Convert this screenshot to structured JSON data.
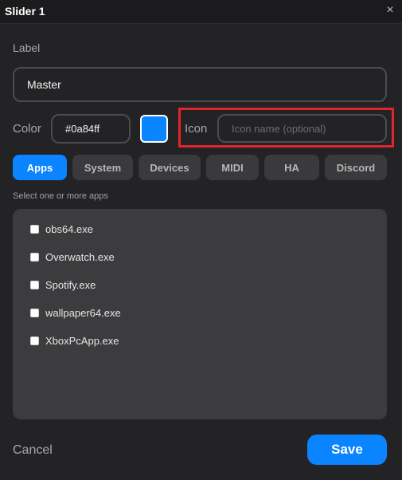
{
  "window": {
    "title": "Slider 1",
    "close_glyph": "×"
  },
  "form": {
    "label_caption": "Label",
    "label_value": "Master",
    "color_caption": "Color",
    "color_value": "#0a84ff",
    "swatch_color": "#0a84ff",
    "icon_caption": "Icon",
    "icon_value": "",
    "icon_placeholder": "Icon name (optional)"
  },
  "tabs": [
    {
      "label": "Apps",
      "active": true
    },
    {
      "label": "System",
      "active": false
    },
    {
      "label": "Devices",
      "active": false
    },
    {
      "label": "MIDI",
      "active": false
    },
    {
      "label": "HA",
      "active": false
    },
    {
      "label": "Discord",
      "active": false
    }
  ],
  "apps_section": {
    "caption": "Select one or more apps",
    "items": [
      {
        "name": "obs64.exe",
        "checked": false
      },
      {
        "name": "Overwatch.exe",
        "checked": false
      },
      {
        "name": "Spotify.exe",
        "checked": false
      },
      {
        "name": "wallpaper64.exe",
        "checked": false
      },
      {
        "name": "XboxPcApp.exe",
        "checked": false
      }
    ]
  },
  "footer": {
    "cancel_label": "Cancel",
    "save_label": "Save"
  },
  "colors": {
    "accent": "#0a84ff",
    "highlight": "#e0262b"
  }
}
